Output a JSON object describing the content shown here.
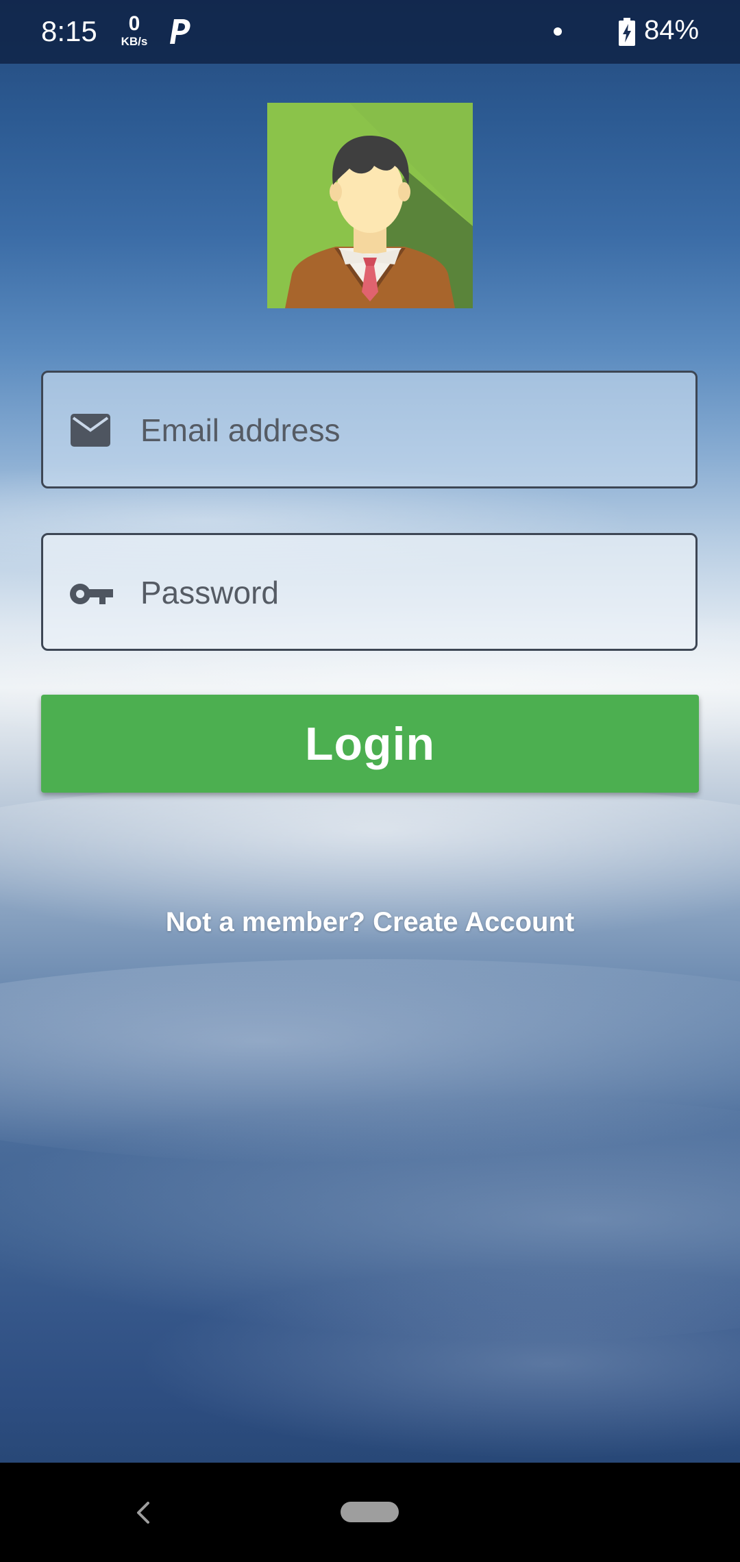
{
  "status_bar": {
    "time": "8:15",
    "speed_value": "0",
    "speed_unit": "KB/s",
    "battery_percent": "84%",
    "icons": [
      "parking-icon",
      "notification-dot-icon",
      "battery-charging-icon"
    ]
  },
  "login_form": {
    "avatar_icon": "user-avatar-icon",
    "email_placeholder": "Email address",
    "email_icon": "envelope-icon",
    "password_placeholder": "Password",
    "password_icon": "key-icon",
    "login_label": "Login",
    "signup_text": "Not a member? Create Account"
  },
  "colors": {
    "login_button": "#4caf50",
    "status_bar": "#0f2346",
    "field_border": "#3d4654",
    "nav_home": "#9e9e9e"
  }
}
